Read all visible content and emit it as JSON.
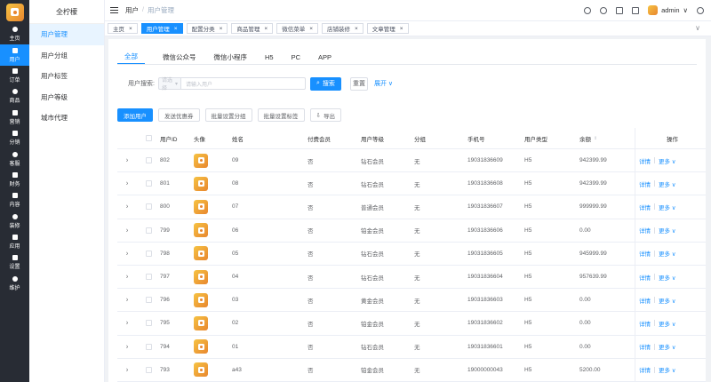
{
  "rail": {
    "items": [
      {
        "label": "主页",
        "icon": "home-icon"
      },
      {
        "label": "用户",
        "icon": "user-icon",
        "active": true
      },
      {
        "label": "订单",
        "icon": "order-icon"
      },
      {
        "label": "商品",
        "icon": "goods-icon"
      },
      {
        "label": "营销",
        "icon": "marketing-icon"
      },
      {
        "label": "分销",
        "icon": "distribution-icon"
      },
      {
        "label": "客服",
        "icon": "service-icon"
      },
      {
        "label": "财务",
        "icon": "finance-icon"
      },
      {
        "label": "内容",
        "icon": "content-icon"
      },
      {
        "label": "装修",
        "icon": "decorate-icon"
      },
      {
        "label": "应用",
        "icon": "app-icon"
      },
      {
        "label": "设置",
        "icon": "settings-icon"
      },
      {
        "label": "维护",
        "icon": "maintain-icon"
      }
    ]
  },
  "submenu": {
    "title": "全柠檬",
    "items": [
      {
        "label": "用户管理",
        "active": true
      },
      {
        "label": "用户分组"
      },
      {
        "label": "用户标签"
      },
      {
        "label": "用户等级"
      },
      {
        "label": "城市代理"
      }
    ]
  },
  "header": {
    "crumb_root": "用户",
    "crumb_sep": "/",
    "crumb_current": "用户管理",
    "username": "admin",
    "caret": "∨"
  },
  "tabs": [
    {
      "label": "主页",
      "active": false
    },
    {
      "label": "用户管理",
      "active": true
    },
    {
      "label": "配置分类",
      "active": false
    },
    {
      "label": "商品管理",
      "active": false
    },
    {
      "label": "微信菜单",
      "active": false
    },
    {
      "label": "店铺装修",
      "active": false
    },
    {
      "label": "文章管理",
      "active": false
    }
  ],
  "tab_close": "×",
  "tab_more": "∨",
  "subtabs": [
    "全部",
    "微信公众号",
    "微信小程序",
    "H5",
    "PC",
    "APP"
  ],
  "search": {
    "label": "用户搜索:",
    "select_value": "请选择",
    "placeholder": "请输入用户",
    "search_btn": "搜索",
    "reset_btn": "重置",
    "expand": "展开 ∨"
  },
  "actions": {
    "add": "添加用户",
    "coupon": "发送优惠券",
    "set_group": "批量设置分组",
    "set_tag": "批量设置标签",
    "export": "导出"
  },
  "table": {
    "headers": {
      "id": "用户ID",
      "avatar": "头像",
      "name": "姓名",
      "paid": "付费会员",
      "level": "用户等级",
      "group": "分组",
      "phone": "手机号",
      "type": "用户类型",
      "balance": "余额",
      "op": "操作"
    },
    "detail": "详情",
    "more": "更多 ∨",
    "expand": "›",
    "sort": "⇕",
    "rows": [
      {
        "id": "802",
        "name": "09",
        "paid": "否",
        "level": "钻石会员",
        "group": "无",
        "phone": "19031836609",
        "type": "H5",
        "balance": "942399.99"
      },
      {
        "id": "801",
        "name": "08",
        "paid": "否",
        "level": "钻石会员",
        "group": "无",
        "phone": "19031836608",
        "type": "H5",
        "balance": "942399.99"
      },
      {
        "id": "800",
        "name": "07",
        "paid": "否",
        "level": "普通会员",
        "group": "无",
        "phone": "19031836607",
        "type": "H5",
        "balance": "999999.99"
      },
      {
        "id": "799",
        "name": "06",
        "paid": "否",
        "level": "铂金会员",
        "group": "无",
        "phone": "19031836606",
        "type": "H5",
        "balance": "0.00"
      },
      {
        "id": "798",
        "name": "05",
        "paid": "否",
        "level": "钻石会员",
        "group": "无",
        "phone": "19031836605",
        "type": "H5",
        "balance": "945999.99"
      },
      {
        "id": "797",
        "name": "04",
        "paid": "否",
        "level": "钻石会员",
        "group": "无",
        "phone": "19031836604",
        "type": "H5",
        "balance": "957639.99"
      },
      {
        "id": "796",
        "name": "03",
        "paid": "否",
        "level": "黄金会员",
        "group": "无",
        "phone": "19031836603",
        "type": "H5",
        "balance": "0.00"
      },
      {
        "id": "795",
        "name": "02",
        "paid": "否",
        "level": "铂金会员",
        "group": "无",
        "phone": "19031836602",
        "type": "H5",
        "balance": "0.00"
      },
      {
        "id": "794",
        "name": "01",
        "paid": "否",
        "level": "钻石会员",
        "group": "无",
        "phone": "19031836601",
        "type": "H5",
        "balance": "0.00"
      },
      {
        "id": "793",
        "name": "a43",
        "paid": "否",
        "level": "铂金会员",
        "group": "无",
        "phone": "19000000043",
        "type": "H5",
        "balance": "5200.00"
      }
    ]
  },
  "colors": {
    "primary": "#1890ff",
    "rail_bg": "#282c34",
    "logo": "#e8862e"
  }
}
